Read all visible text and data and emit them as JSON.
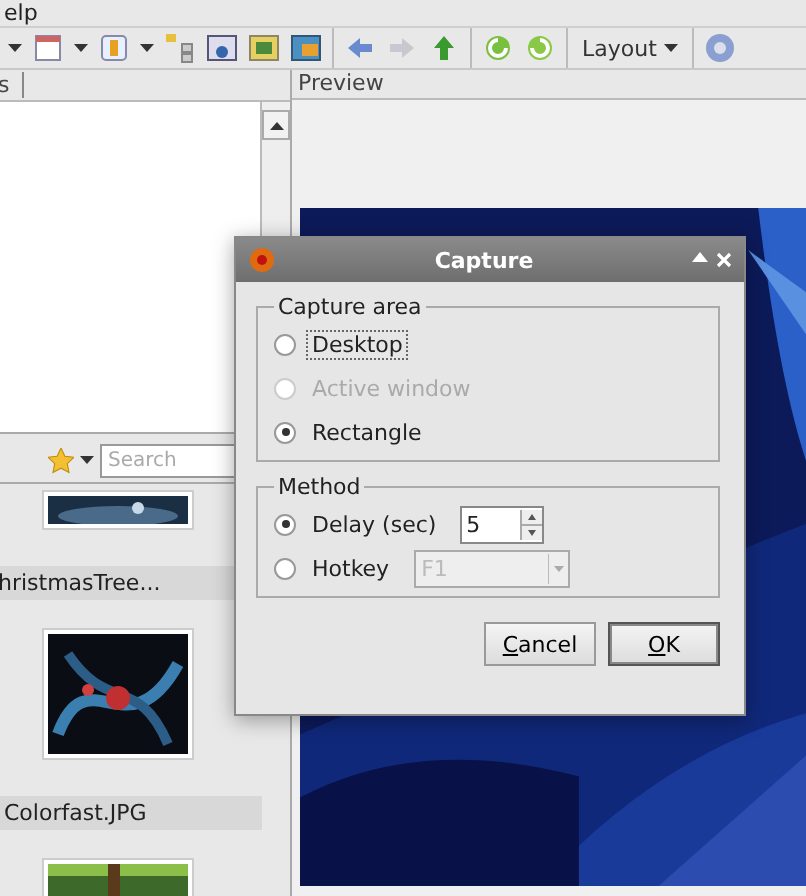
{
  "menu_bar": {
    "items": [
      "elp"
    ]
  },
  "toolbar": {
    "layout_label": "Layout"
  },
  "left_panel": {
    "tab": "s",
    "search": {
      "placeholder": "Search"
    },
    "thumbnails": [
      {
        "caption": "hristmasTree..."
      },
      {
        "caption": "Colorfast.JPG"
      }
    ]
  },
  "preview": {
    "title": "Preview"
  },
  "dialog": {
    "title": "Capture",
    "capture_area": {
      "title": "Capture area",
      "options": [
        {
          "label": "Desktop",
          "selected": false,
          "disabled": false
        },
        {
          "label": "Active window",
          "selected": false,
          "disabled": true
        },
        {
          "label": "Rectangle",
          "selected": true,
          "disabled": false
        }
      ]
    },
    "method": {
      "title": "Method",
      "options": [
        {
          "label": "Delay (sec)",
          "selected": true,
          "kind": "spin",
          "value": "5"
        },
        {
          "label": "Hotkey",
          "selected": false,
          "kind": "combo",
          "value": "F1",
          "disabled": true
        }
      ]
    },
    "buttons": [
      {
        "label": "Cancel",
        "default": false
      },
      {
        "label": "OK",
        "default": true
      }
    ]
  }
}
